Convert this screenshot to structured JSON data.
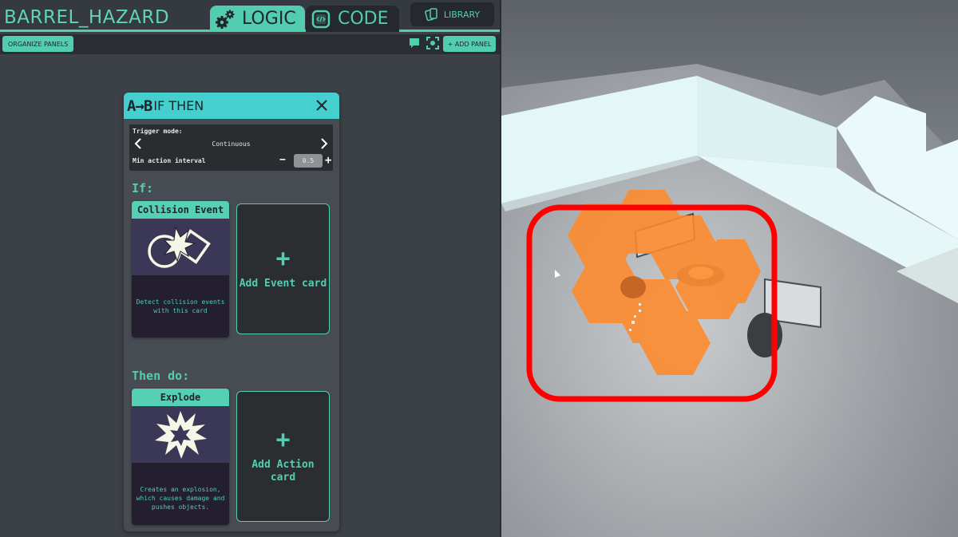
{
  "header": {
    "project_title": "BARREL_HAZARD",
    "tabs": [
      {
        "label": "LOGIC",
        "icon": "gears-icon",
        "active": true
      },
      {
        "label": "CODE",
        "icon": "code-icon",
        "active": false
      }
    ],
    "library_label": "LIBRARY"
  },
  "toolbar": {
    "organize_label": "ORGANIZE PANELS",
    "add_panel_label": "+ ADD PANEL"
  },
  "panel": {
    "ab_label": "A→B",
    "title": "IF THEN",
    "trigger_mode_label": "Trigger mode:",
    "trigger_mode_value": "Continuous",
    "min_interval_label": "Min action interval",
    "min_interval_value": "0.5",
    "if_label": "If:",
    "then_label": "Then do:",
    "event_card": {
      "title": "Collision Event",
      "description": "Detect collision events with this card"
    },
    "add_event_label": "Add Event card",
    "action_card": {
      "title": "Explode",
      "description": "Creates an explosion, which causes damage and pushes objects."
    },
    "add_action_label": "Add Action card",
    "plus_symbol": "+"
  },
  "colors": {
    "accent": "#52cdb0",
    "panel_header": "#45cfcf",
    "highlight_red": "#ff0000",
    "explosion_orange": "#ff8a2a"
  }
}
